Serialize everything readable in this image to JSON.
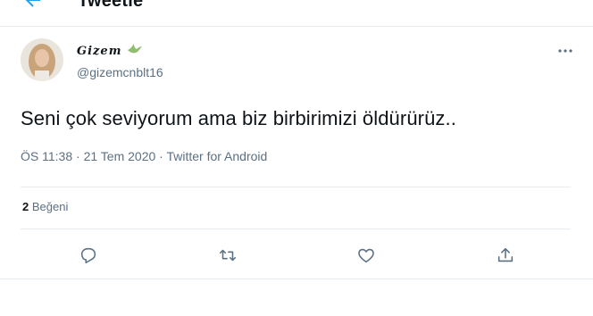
{
  "header": {
    "title": "Tweetle"
  },
  "tweet": {
    "display_name": "Gizem",
    "handle": "@gizemcnblt16",
    "text": "Seni çok seviyorum ama biz birbirimizi öldürürüz..",
    "time": "ÖS 11:38",
    "date": "21 Tem 2020",
    "source": "Twitter for Android",
    "likes_count": "2",
    "likes_label": "Beğeni"
  },
  "icons": {
    "back": "back-arrow-icon",
    "more": "more-horizontal-icon",
    "reply": "reply-icon",
    "retweet": "retweet-icon",
    "like": "heart-icon",
    "share": "share-icon",
    "accent": "#1da1f2",
    "muted": "#5b7083"
  }
}
